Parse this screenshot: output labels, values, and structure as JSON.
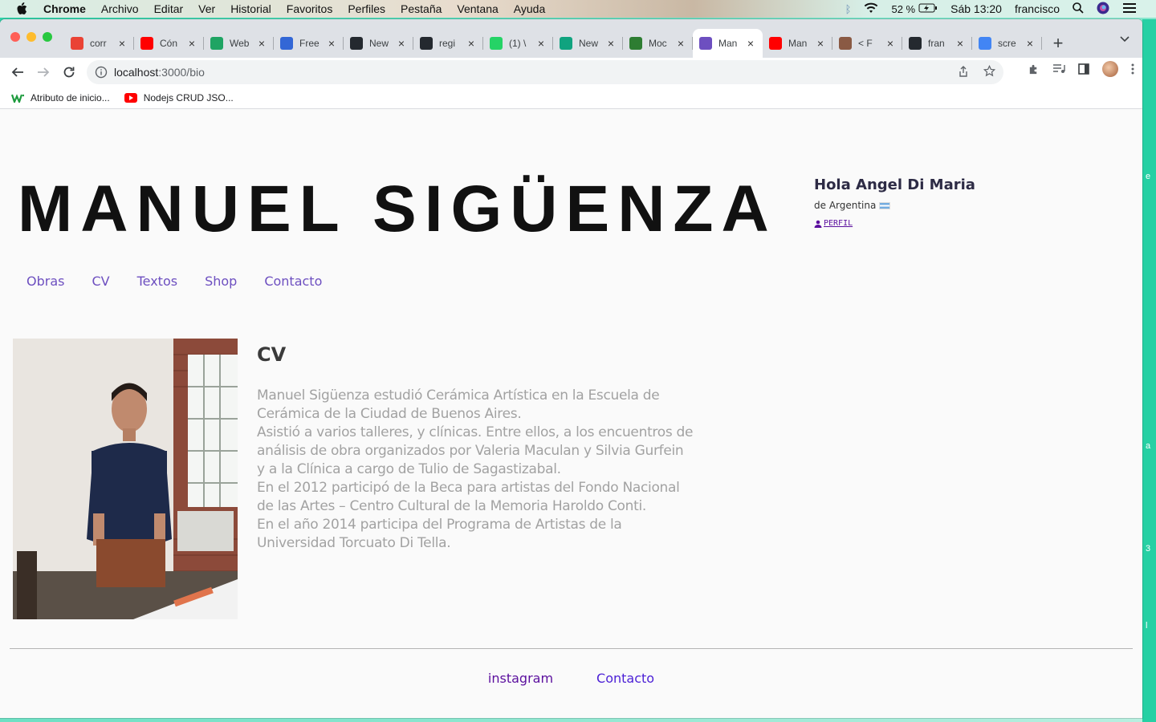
{
  "menubar": {
    "app": "Chrome",
    "items": [
      "Archivo",
      "Editar",
      "Ver",
      "Historial",
      "Favoritos",
      "Perfiles",
      "Pestaña",
      "Ventana",
      "Ayuda"
    ],
    "battery": "52 %",
    "clock": "Sáb 13:20",
    "user": "francisco"
  },
  "tabs": [
    {
      "label": "corr",
      "color": "#ea4335",
      "icon": "gmail-icon"
    },
    {
      "label": "Cón",
      "color": "#ff0000",
      "icon": "youtube-icon"
    },
    {
      "label": "Web",
      "color": "#1fa463",
      "icon": "drive-icon"
    },
    {
      "label": "Free",
      "color": "#3367d6",
      "icon": "flag-icon"
    },
    {
      "label": "New",
      "color": "#24292f",
      "icon": "github-icon"
    },
    {
      "label": "regi",
      "color": "#24292f",
      "icon": "github-icon"
    },
    {
      "label": "(1) \\",
      "color": "#25d366",
      "icon": "whatsapp-icon"
    },
    {
      "label": "New",
      "color": "#10a37f",
      "icon": "openai-icon"
    },
    {
      "label": "Moc",
      "color": "#2e7d32",
      "icon": "mockaroo-icon"
    },
    {
      "label": "Man",
      "color": "#6d4fc0",
      "icon": "site-icon",
      "active": true
    },
    {
      "label": "Man",
      "color": "#ff0000",
      "icon": "youtube-icon"
    },
    {
      "label": "< F",
      "color": "#8a5a44",
      "icon": "avatar-icon"
    },
    {
      "label": "fran",
      "color": "#24292f",
      "icon": "github-icon"
    },
    {
      "label": "scre",
      "color": "#4285f4",
      "icon": "google-icon"
    }
  ],
  "address": {
    "host": "localhost",
    "path": ":3000/bio"
  },
  "bookmarks": [
    {
      "label": "Atributo de inicio...",
      "icon": "w-icon"
    },
    {
      "label": "Nodejs CRUD JSO...",
      "icon": "youtube-icon"
    }
  ],
  "site": {
    "title": "MANUEL SIGÜENZA",
    "greeting": "Hola Angel Di Maria",
    "country": "de Argentina",
    "profile_link": "PERFIL",
    "nav": [
      "Obras",
      "CV",
      "Textos",
      "Shop",
      "Contacto"
    ],
    "bio_heading": "CV",
    "bio_lines": [
      "Manuel Sigüenza estudió Cerámica Artística en la Escuela de",
      "Cerámica de la Ciudad de Buenos Aires.",
      "Asistió a varios talleres, y clínicas. Entre ellos, a los encuentros de",
      "análisis de obra organizados por Valeria Maculan y Silvia Gurfein",
      "y a la Clínica a cargo de Tulio de Sagastizabal.",
      "En el 2012 participó de la Beca para artistas del Fondo Nacional",
      "de las Artes – Centro Cultural de la Memoria Haroldo Conti.",
      "En el año 2014 participa del Programa de Artistas de la",
      "Universidad Torcuato Di Tella."
    ],
    "footer": {
      "instagram": "instagram",
      "contacto": "Contacto"
    }
  },
  "colors": {
    "nav_link": "#6d4fc0",
    "footer_instagram": "#5b0f9e",
    "footer_contact": "#4b1fd6",
    "body_text": "#a2a2a2"
  }
}
